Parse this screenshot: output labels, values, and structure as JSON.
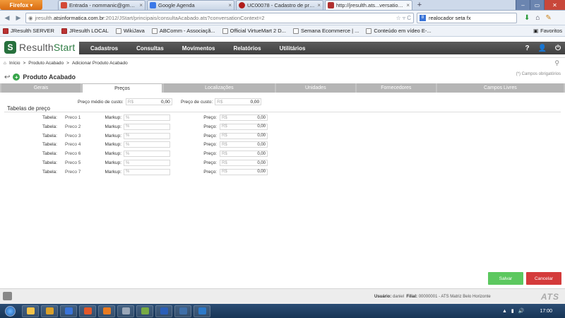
{
  "browser": {
    "app_button": "Firefox",
    "tabs": [
      {
        "title": "Entrada - nommanic@gmail.com - G...",
        "fav_color": "#d34836"
      },
      {
        "title": "Google Agenda",
        "fav_color": "#3b78e7"
      },
      {
        "title": "UC00078 - Cadastro de produto acab...",
        "fav_color": "#b01c1c"
      },
      {
        "title": "http://jresulth.ats...versationContext=2",
        "fav_color": "#b03030"
      }
    ],
    "url_prefix": "jresulth.",
    "url_domain": "atsinformatica.com.br",
    "url_rest": ":2012/JStart/principais/consultaAcabado.ats?conversationContext=2",
    "search_value": "realocador seta fx",
    "bookmarks": [
      "JResulth SERVER",
      "JResulth LOCAL",
      "WikiJava",
      "ABComm - Associaçã...",
      "Official VirtueMart 2 D...",
      "Semana Ecommerce | ...",
      "Conteúdo em vídeo E-..."
    ],
    "favorites_label": "Favoritos"
  },
  "app": {
    "logo_letter": "S",
    "logo_part1": "Resulth",
    "logo_part2": "Start",
    "menu": [
      "Cadastros",
      "Consultas",
      "Movimentos",
      "Relatórios",
      "Utilitários"
    ],
    "help_icon_text": "?"
  },
  "breadcrumb": {
    "home": "Início",
    "items": [
      "Produto Acabado",
      "Adicionar Produto Acabado"
    ]
  },
  "page": {
    "title": "Produto Acabado",
    "required_note": "(*) Campos obrigatórios"
  },
  "tabs": [
    "Gerais",
    "Preços",
    "Localizações",
    "Unidades",
    "Fornecedores",
    "Campos Livres"
  ],
  "active_tab": "Preços",
  "summary": {
    "avg_cost_label": "Preço médio de custo:",
    "avg_cost_currency": "R$",
    "avg_cost_value": "0,00",
    "cost_label": "Preço de custo:",
    "cost_currency": "R$",
    "cost_value": "0,00"
  },
  "price_tables": {
    "title": "Tabelas de preço",
    "table_label": "Tabela:",
    "markup_label": "Markup:",
    "markup_placeholder": "%",
    "price_label": "Preço:",
    "price_currency": "R$",
    "rows": [
      {
        "name": "Preco 1",
        "price": "0,00"
      },
      {
        "name": "Preco 2",
        "price": "0,00"
      },
      {
        "name": "Preco 3",
        "price": "0,00"
      },
      {
        "name": "Preco 4",
        "price": "0,00"
      },
      {
        "name": "Preco 6",
        "price": "0,00"
      },
      {
        "name": "Preco 5",
        "price": "0,00"
      },
      {
        "name": "Preco 7",
        "price": "0,00"
      }
    ]
  },
  "actions": {
    "save": "Salvar",
    "cancel": "Cancelar"
  },
  "footer": {
    "user_label": "Usuário:",
    "user": "daniel",
    "branch_label": "Filial:",
    "branch": "00000001 - ATS Matriz Belo Horizonte",
    "brand": "ATS"
  },
  "taskbar": {
    "clock": "17:00",
    "apps": [
      "#f3c34a",
      "#d9a02a",
      "#3a74d8",
      "#e2582a",
      "#e87b22",
      "#9aa7b8",
      "#77aa44",
      "#2b5fb8",
      "#3f6fa8",
      "#2c79c9"
    ]
  },
  "colors": {
    "brand_green": "#27713d",
    "save": "#5cc85f",
    "cancel": "#d43b3b"
  }
}
